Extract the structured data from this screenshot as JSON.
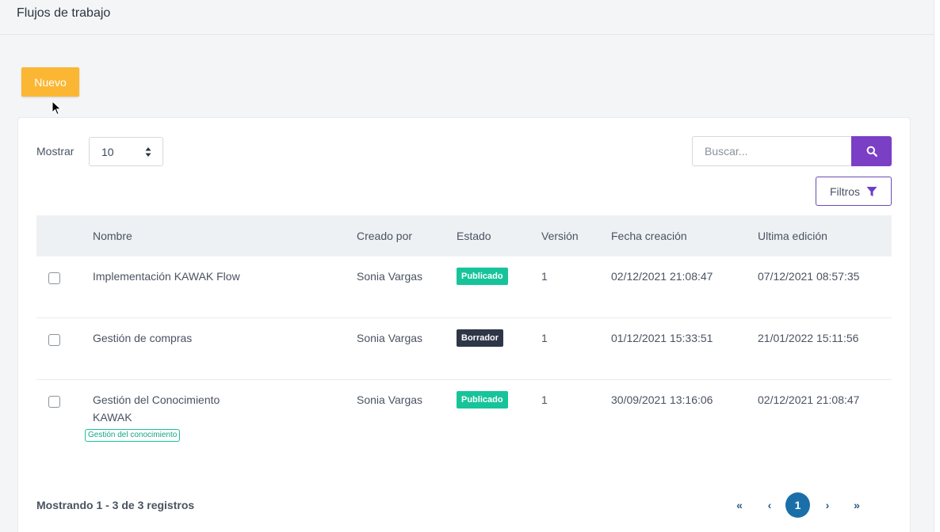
{
  "header": {
    "title": "Flujos de trabajo"
  },
  "actions": {
    "new_label": "Nuevo"
  },
  "controls": {
    "show_label": "Mostrar",
    "show_value": "10",
    "search_placeholder": "Buscar...",
    "filters_label": "Filtros"
  },
  "table": {
    "columns": [
      "Nombre",
      "Creado por",
      "Estado",
      "Versión",
      "Fecha creación",
      "Ultima edición"
    ],
    "rows": [
      {
        "name": "Implementación KAWAK Flow",
        "created_by": "Sonia Vargas",
        "status": "Publicado",
        "version": "1",
        "created": "02/12/2021 21:08:47",
        "edited": "07/12/2021 08:57:35"
      },
      {
        "name": "Gestión de compras",
        "created_by": "Sonia Vargas",
        "status": "Borrador",
        "version": "1",
        "created": "01/12/2021 15:33:51",
        "edited": "21/01/2022 15:11:56"
      },
      {
        "name_line1": "Gestión del Conocimiento",
        "name_line2": "KAWAK",
        "tag": "Gestión del conocimiento",
        "created_by": "Sonia Vargas",
        "status": "Publicado",
        "version": "1",
        "created": "30/09/2021 13:16:06",
        "edited": "02/12/2021 21:08:47"
      }
    ]
  },
  "footer": {
    "summary": "Mostrando 1 - 3 de 3 registros",
    "pagination": {
      "first": "«",
      "prev": "‹",
      "current": "1",
      "next": "›",
      "last": "»"
    }
  },
  "colors": {
    "new_button": "#fbb733",
    "search_button": "#7b3fc6",
    "published_badge": "#17c49a",
    "draft_badge": "#2e3647",
    "active_page": "#1b6fa8"
  }
}
